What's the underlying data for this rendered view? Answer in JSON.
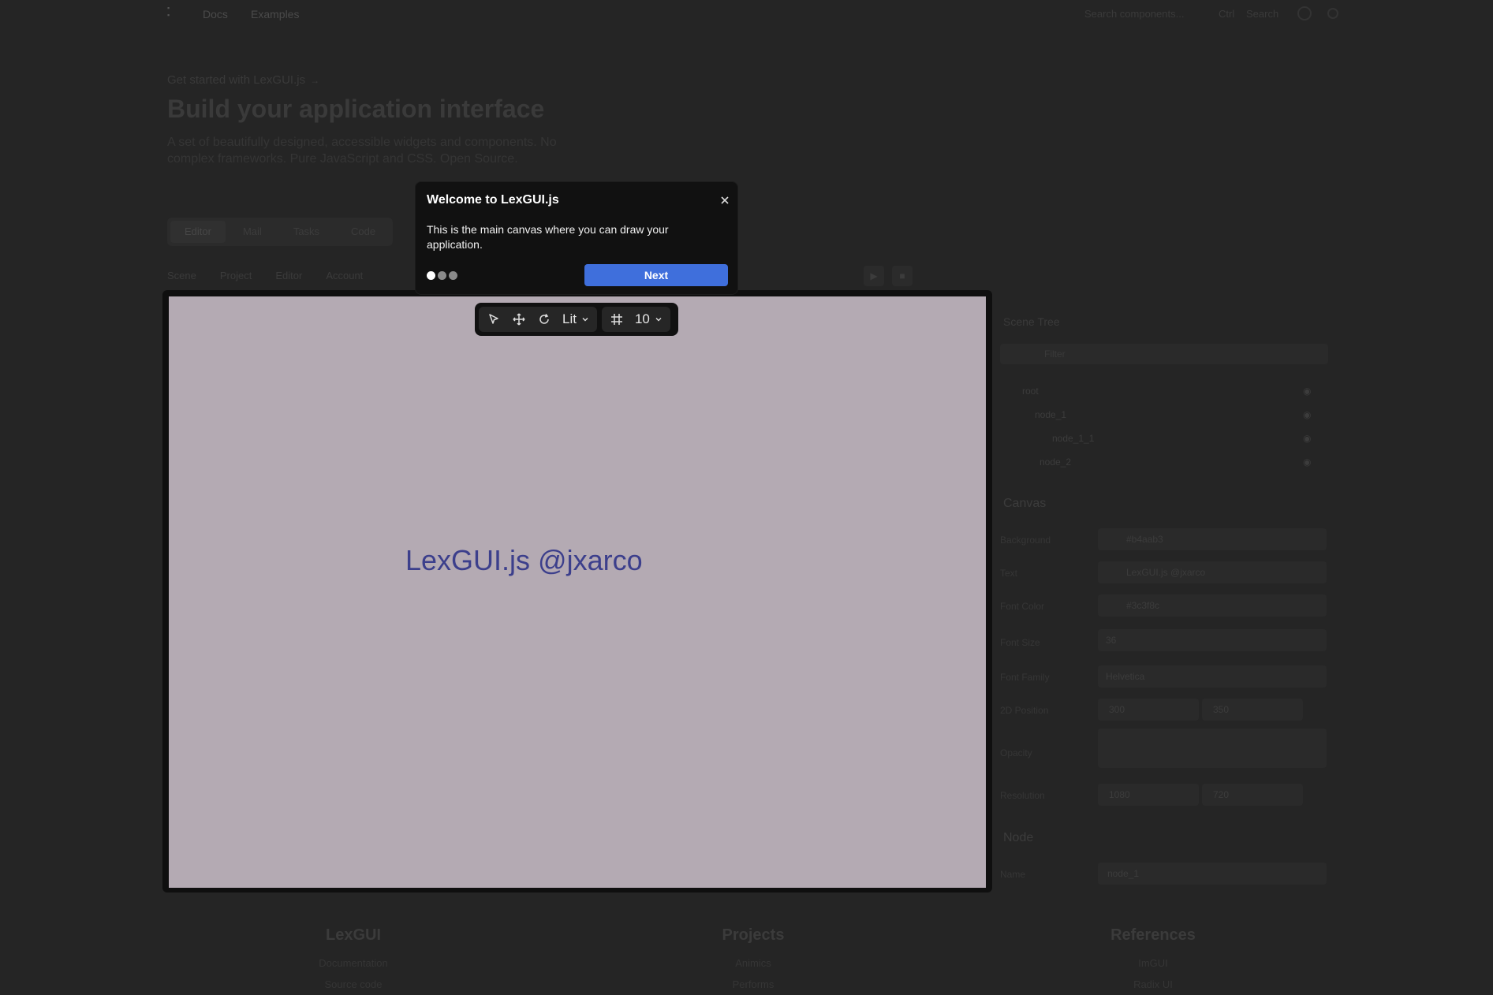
{
  "nav": {
    "links": [
      "Docs",
      "Examples"
    ],
    "search_placeholder": "Search components...",
    "shortcut": "Ctrl",
    "shortcut_key": "Search"
  },
  "hero": {
    "eyebrow": "Get started with LexGUI.js",
    "eyebrow_tag": "→",
    "title": "Build your application interface",
    "description": "A set of beautifully designed, accessible widgets and components. No complex frameworks. Pure JavaScript and CSS. Open Source."
  },
  "tabs": [
    "Editor",
    "Mail",
    "Tasks",
    "Code"
  ],
  "menubar": [
    "Scene",
    "Project",
    "Editor",
    "Account"
  ],
  "canvas": {
    "text": "LexGUI.js @jxarco",
    "background": "#b4aab3",
    "text_color": "#3c3f8c"
  },
  "toolbar": {
    "shading": "Lit",
    "grid_size": "10"
  },
  "scene_tree": {
    "title": "Scene Tree",
    "filter_placeholder": "Filter",
    "items": [
      "root",
      "node_1",
      "node_1_1",
      "node_2"
    ]
  },
  "canvas_section": {
    "title": "Canvas",
    "props": [
      {
        "label": "Background",
        "value": "#b4aab3"
      },
      {
        "label": "Text",
        "value": "LexGUI.js @jxarco"
      },
      {
        "label": "Font Color",
        "value": "#3c3f8c"
      },
      {
        "label": "Font Size",
        "value": "36"
      },
      {
        "label": "Font Family",
        "value": "Helvetica"
      },
      {
        "label": "2D Position",
        "value_x": "300",
        "value_y": "350"
      },
      {
        "label": "Opacity",
        "value": ""
      },
      {
        "label": "Resolution",
        "value_x": "1080",
        "value_y": "720"
      }
    ]
  },
  "node_section": {
    "title": "Node",
    "name_label": "Name",
    "name_value": "node_1"
  },
  "footer": [
    {
      "title": "LexGUI",
      "links": [
        "Documentation",
        "Source code"
      ]
    },
    {
      "title": "Projects",
      "links": [
        "Animics",
        "Performs"
      ]
    },
    {
      "title": "References",
      "links": [
        "ImGUI",
        "Radix UI"
      ]
    }
  ],
  "tour": {
    "title": "Welcome to LexGUI.js",
    "body": "This is the main canvas where you can draw your application.",
    "next_label": "Next",
    "step": 1,
    "total_steps": 3
  }
}
